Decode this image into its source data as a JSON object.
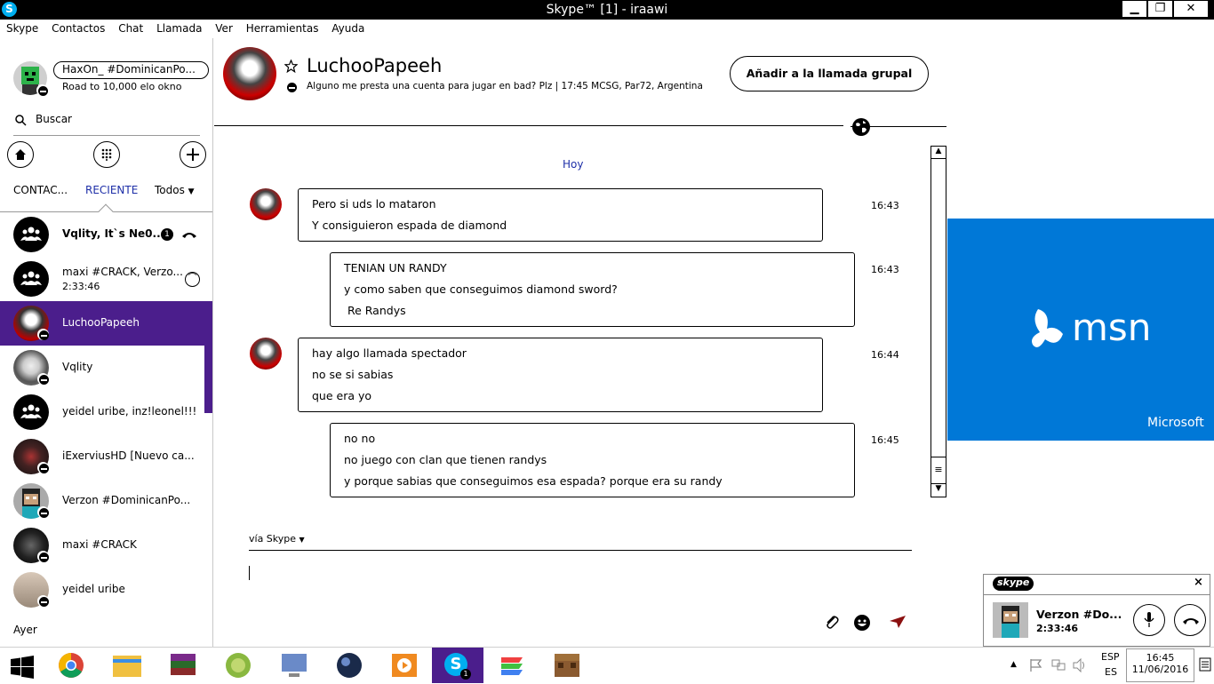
{
  "window": {
    "title": "Skype™ [1] - iraawi",
    "app_icon": "skype-icon",
    "min": "▁",
    "max": "❐",
    "close": "✕"
  },
  "menu": [
    "Skype",
    "Contactos",
    "Chat",
    "Llamada",
    "Ver",
    "Herramientas",
    "Ayuda"
  ],
  "profile": {
    "name": "HaxOn_ #DominicanPo...",
    "mood": "Road to 10,000 elo okno"
  },
  "search": {
    "placeholder": "Buscar"
  },
  "tabs": {
    "contacts": "CONTAC...",
    "recent": "RECIENTE",
    "all": "Todos"
  },
  "contacts": [
    {
      "name": "Vqlity, It`s Ne0...",
      "badge": "1",
      "type": "group",
      "bold": true
    },
    {
      "name": "maxi #CRACK, Verzo...",
      "sub": "2:33:46",
      "type": "group"
    },
    {
      "name": "LuchooPapeeh",
      "type": "user",
      "selected": true
    },
    {
      "name": "Vqlity",
      "type": "user"
    },
    {
      "name": "yeidel uribe, inz!leonel!!!",
      "type": "group"
    },
    {
      "name": "iExerviusHD [Nuevo ca...",
      "type": "user"
    },
    {
      "name": "Verzon #DominicanPo...",
      "type": "user"
    },
    {
      "name": "maxi #CRACK",
      "type": "user"
    },
    {
      "name": "yeidel uribe",
      "type": "user"
    }
  ],
  "section_yesterday": "Ayer",
  "chat": {
    "contact_name": "LuchooPapeeh",
    "status": "Alguno me presta una cuenta para jugar en bad? Plz  |  17:45 MCSG, Par72, Argentina",
    "add_call_button": "Añadir a la llamada grupal",
    "day_label": "Hoy",
    "messages": [
      {
        "from": "other",
        "time": "16:43",
        "lines": [
          "Pero si uds lo mataron",
          "Y consiguieron espada de diamond"
        ]
      },
      {
        "from": "me",
        "time": "16:43",
        "lines": [
          "TENIAN UN RANDY",
          "y como saben que conseguimos diamond sword?",
          " Re Randys"
        ]
      },
      {
        "from": "other",
        "time": "16:44",
        "lines": [
          "hay algo llamada spectador",
          "no se si sabias",
          "que era yo"
        ]
      },
      {
        "from": "me",
        "time": "16:45",
        "lines": [
          "no no",
          "no juego con clan que tienen randys",
          "y porque sabias que conseguimos esa espada? porque era su randy"
        ]
      }
    ],
    "via": "vía Skype"
  },
  "ad": {
    "brand": "msn",
    "company": "Microsoft"
  },
  "call_window": {
    "logo": "skype",
    "name": "Verzon #Do...",
    "duration": "2:33:46"
  },
  "taskbar": {
    "lang1": "ESP",
    "lang2": "ES",
    "time": "16:45",
    "date": "11/06/2016",
    "skype_badge": "1"
  },
  "colors": {
    "accent": "#4b1e8c",
    "skype_blue": "#00aff0",
    "ad_blue": "#0078d7",
    "link_blue": "#1e2fa8"
  }
}
